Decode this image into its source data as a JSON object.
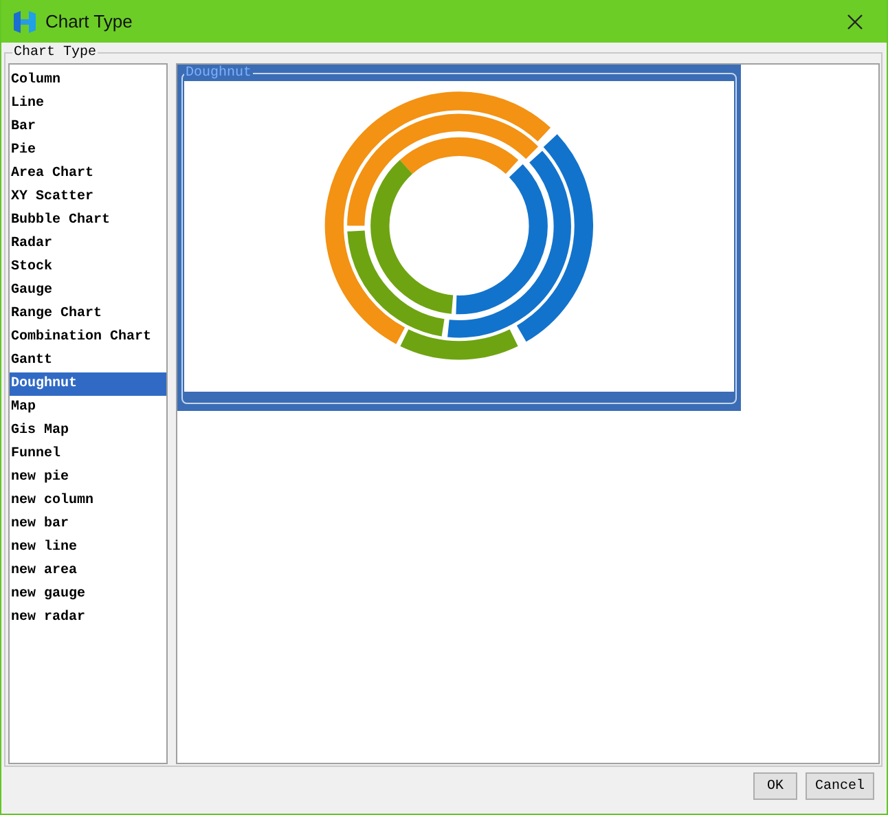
{
  "window": {
    "title": "Chart Type"
  },
  "group": {
    "title": "Chart Type"
  },
  "chart_types": [
    {
      "label": "Column",
      "selected": false
    },
    {
      "label": "Line",
      "selected": false
    },
    {
      "label": "Bar",
      "selected": false
    },
    {
      "label": "Pie",
      "selected": false
    },
    {
      "label": "Area Chart",
      "selected": false
    },
    {
      "label": "XY Scatter",
      "selected": false
    },
    {
      "label": "Bubble Chart",
      "selected": false
    },
    {
      "label": "Radar",
      "selected": false
    },
    {
      "label": "Stock",
      "selected": false
    },
    {
      "label": "Gauge",
      "selected": false
    },
    {
      "label": "Range Chart",
      "selected": false
    },
    {
      "label": "Combination Chart",
      "selected": false
    },
    {
      "label": "Gantt",
      "selected": false
    },
    {
      "label": "Doughnut",
      "selected": true
    },
    {
      "label": "Map",
      "selected": false
    },
    {
      "label": "Gis Map",
      "selected": false
    },
    {
      "label": "Funnel",
      "selected": false
    },
    {
      "label": "new pie",
      "selected": false
    },
    {
      "label": "new column",
      "selected": false
    },
    {
      "label": "new bar",
      "selected": false
    },
    {
      "label": "new line",
      "selected": false
    },
    {
      "label": "new area",
      "selected": false
    },
    {
      "label": "new gauge",
      "selected": false
    },
    {
      "label": "new radar",
      "selected": false
    }
  ],
  "preview": {
    "title": "Doughnut"
  },
  "buttons": [
    "OK",
    "Cancel"
  ]
}
